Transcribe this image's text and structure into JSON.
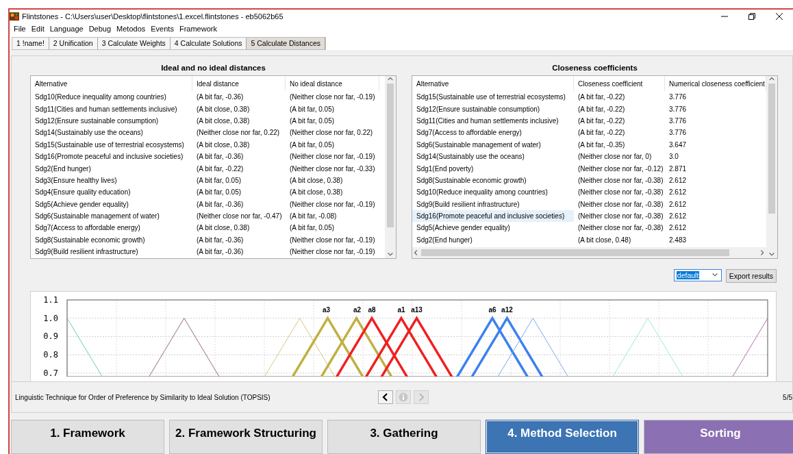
{
  "window": {
    "title": "Flintstones - C:\\Users\\user\\Desktop\\flintstones\\1.excel.flintstones - eb5062b65"
  },
  "menu": [
    "File",
    "Edit",
    "Language",
    "Debug",
    "Metodos",
    "Events",
    "Framework"
  ],
  "steps": [
    {
      "label": "1 !name!",
      "selected": false
    },
    {
      "label": "2 Unification",
      "selected": false
    },
    {
      "label": "3 Calculate Weights",
      "selected": false
    },
    {
      "label": "4 Calculate Solutions",
      "selected": false
    },
    {
      "label": "5 Calculate Distances",
      "selected": true
    }
  ],
  "distances": {
    "title": "Ideal and no ideal distances",
    "columns": [
      "Alternative",
      "Ideal distance",
      "No ideal distance"
    ],
    "rows": [
      [
        "Sdg10(Reduce inequality among countries)",
        "(A bit far, -0.36)",
        "(Neither close nor far, -0.19)"
      ],
      [
        "Sdg11(Cities and human settlements inclusive)",
        "(A bit close, 0.38)",
        "(A bit far, 0.05)"
      ],
      [
        "Sdg12(Ensure sustainable consumption)",
        "(A bit close, 0.38)",
        "(A bit far, 0.05)"
      ],
      [
        "Sdg14(Sustainably use the oceans)",
        "(Neither close nor far, 0.22)",
        "(Neither close nor far, 0.22)"
      ],
      [
        "Sdg15(Sustainable use of terrestrial ecosystems)",
        "(A bit close, 0.38)",
        "(A bit far, 0.05)"
      ],
      [
        "Sdg16(Promote peaceful and inclusive societies)",
        "(A bit far, -0.36)",
        "(Neither close nor far, -0.19)"
      ],
      [
        "Sdg2(End hunger)",
        "(A bit far, -0.22)",
        "(Neither close nor far, -0.33)"
      ],
      [
        "Sdg3(Ensure healthy lives)",
        "(A bit far, 0.05)",
        "(A bit close, 0.38)"
      ],
      [
        "Sdg4(Ensure quality education)",
        "(A bit far, 0.05)",
        "(A bit close, 0.38)"
      ],
      [
        "Sdg5(Achieve gender equality)",
        "(A bit far, -0.36)",
        "(Neither close nor far, -0.19)"
      ],
      [
        "Sdg6(Sustainable management of water)",
        "(Neither close nor far, -0.47)",
        "(A bit far, -0.08)"
      ],
      [
        "Sdg7(Access to affordable energy)",
        "(A bit close, 0.38)",
        "(A bit far, 0.05)"
      ],
      [
        "Sdg8(Sustainable economic growth)",
        "(A bit far, -0.36)",
        "(Neither close nor far, -0.19)"
      ],
      [
        "Sdg9(Build resilient infrastructure)",
        "(A bit far, -0.36)",
        "(Neither close nor far, -0.19)"
      ]
    ]
  },
  "closeness": {
    "title": "Closeness coefficients",
    "columns": [
      "Alternative",
      "Closeness coefficient",
      "Numerical closeness coefficient"
    ],
    "rows": [
      {
        "cells": [
          "Sdg15(Sustainable use of terrestrial ecosystems)",
          "(A bit far, -0.22)",
          "3.776"
        ],
        "selected": false
      },
      {
        "cells": [
          "Sdg12(Ensure sustainable consumption)",
          "(A bit far, -0.22)",
          "3.776"
        ],
        "selected": false
      },
      {
        "cells": [
          "Sdg11(Cities and human settlements inclusive)",
          "(A bit far, -0.22)",
          "3.776"
        ],
        "selected": false
      },
      {
        "cells": [
          "Sdg7(Access to affordable energy)",
          "(A bit far, -0.22)",
          "3.776"
        ],
        "selected": false
      },
      {
        "cells": [
          "Sdg6(Sustainable management of water)",
          "(A bit far, -0.35)",
          "3.647"
        ],
        "selected": false
      },
      {
        "cells": [
          "Sdg14(Sustainably use the oceans)",
          "(Neither close nor far, 0)",
          "3.0"
        ],
        "selected": false
      },
      {
        "cells": [
          "Sdg1(End poverty)",
          "(Neither close nor far, -0.12)",
          "2.871"
        ],
        "selected": false
      },
      {
        "cells": [
          "Sdg8(Sustainable economic growth)",
          "(Neither close nor far, -0.38)",
          "2.612"
        ],
        "selected": false
      },
      {
        "cells": [
          "Sdg10(Reduce inequality among countries)",
          "(Neither close nor far, -0.38)",
          "2.612"
        ],
        "selected": false
      },
      {
        "cells": [
          "Sdg9(Build resilient infrastructure)",
          "(Neither close nor far, -0.38)",
          "2.612"
        ],
        "selected": false
      },
      {
        "cells": [
          "Sdg16(Promote peaceful and inclusive societies)",
          "(Neither close nor far, -0.38)",
          "2.612"
        ],
        "selected": true
      },
      {
        "cells": [
          "Sdg5(Achieve gender equality)",
          "(Neither close nor far, -0.38)",
          "2.612"
        ],
        "selected": false
      },
      {
        "cells": [
          "Sdg2(End hunger)",
          "(A bit close, 0.48)",
          "2.483"
        ],
        "selected": false
      }
    ]
  },
  "export": {
    "dropdown_value": "default",
    "button": "Export results"
  },
  "chart": {
    "yticks": [
      "1.1",
      "1.0",
      "0.9",
      "0.8",
      "0.7"
    ],
    "peak_labels": [
      "a3",
      "a2",
      "a8",
      "a1",
      "a13",
      "a6",
      "a12"
    ]
  },
  "status": {
    "text": "Linguistic Technique for Order of Preference by Similarity to Ideal Solution (TOPSIS)",
    "page": "5/5",
    "nav": [
      {
        "kind": "back",
        "disabled": false
      },
      {
        "kind": "info",
        "disabled": true
      },
      {
        "kind": "forward",
        "disabled": true
      }
    ]
  },
  "bottom_tabs": [
    {
      "label": "1. Framework",
      "color": "#e1e1e1",
      "selected": false
    },
    {
      "label": "2. Framework Structuring",
      "color": "#e1e1e1",
      "selected": false
    },
    {
      "label": "3. Gathering",
      "color": "#e1e1e1",
      "selected": false
    },
    {
      "label": "4. Method Selection",
      "color": "#3c74b4",
      "selected": true
    },
    {
      "label": "Sorting",
      "color": "#8c70b4",
      "selected": false
    }
  ]
}
